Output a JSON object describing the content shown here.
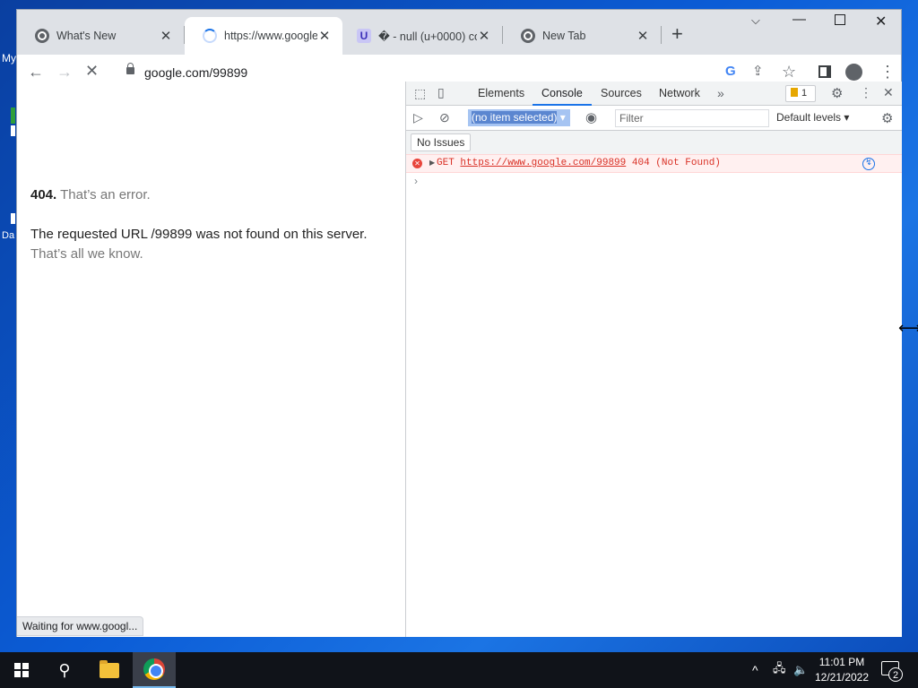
{
  "desktop": {
    "labels": [
      "My",
      "Da"
    ]
  },
  "tabs": [
    {
      "title": "What's New",
      "icon": "chrome-icon",
      "active": false
    },
    {
      "title": "https://www.google.c",
      "icon": "loading-spinner-icon",
      "active": true
    },
    {
      "title": "� - null (u+0000) co",
      "icon": "u-favicon-icon",
      "favicon_letter": "U",
      "active": false
    },
    {
      "title": "New Tab",
      "icon": "chrome-icon",
      "active": false
    }
  ],
  "toolbar": {
    "address": "google.com/99899"
  },
  "page": {
    "error_code": "404.",
    "error_short": "That’s an error.",
    "error_message": "The requested URL /99899 was not found on this server.",
    "error_footer": "That’s all we know.",
    "status_text": "Waiting for www.googl..."
  },
  "devtools": {
    "tabs": [
      "Elements",
      "Console",
      "Sources",
      "Network"
    ],
    "active_tab": "Console",
    "issues_badge": "1",
    "context_select": "(no item selected)",
    "filter_placeholder": "Filter",
    "levels_label": "Default levels",
    "issues_button": "No Issues",
    "console_error": {
      "method": "GET",
      "url": "https://www.google.com/99899",
      "status": "404 (Not Found)"
    },
    "prompt": "›"
  },
  "taskbar": {
    "time": "11:01 PM",
    "date": "12/21/2022",
    "notification_count": "2"
  },
  "colors": {
    "accent": "#1a73e8",
    "error": "#d93025",
    "error_bg": "#fff0f0",
    "taskbar": "#101319"
  }
}
